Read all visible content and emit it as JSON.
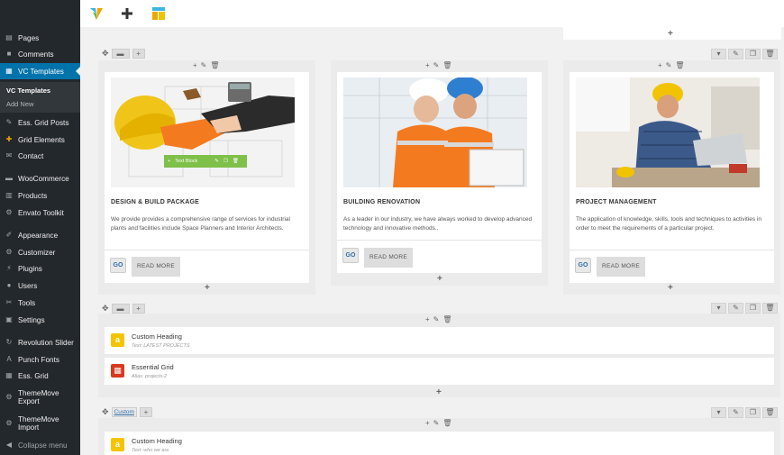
{
  "sidebar": {
    "items": [
      {
        "label": "Pages",
        "icon": "pages-icon"
      },
      {
        "label": "Comments",
        "icon": "comments-icon"
      },
      {
        "label": "VC Templates",
        "icon": "vc-templates-icon"
      },
      {
        "label": "Ess. Grid Posts",
        "icon": "pin-icon"
      },
      {
        "label": "Grid Elements",
        "icon": "grid-elements-icon"
      },
      {
        "label": "Contact",
        "icon": "mail-icon"
      },
      {
        "label": "WooCommerce",
        "icon": "woocommerce-icon"
      },
      {
        "label": "Products",
        "icon": "products-icon"
      },
      {
        "label": "Envato Toolkit",
        "icon": "toolkit-icon"
      },
      {
        "label": "Appearance",
        "icon": "brush-icon"
      },
      {
        "label": "Customizer",
        "icon": "customizer-icon"
      },
      {
        "label": "Plugins",
        "icon": "plugin-icon"
      },
      {
        "label": "Users",
        "icon": "user-icon"
      },
      {
        "label": "Tools",
        "icon": "wrench-icon"
      },
      {
        "label": "Settings",
        "icon": "settings-icon"
      },
      {
        "label": "Revolution Slider",
        "icon": "refresh-icon"
      },
      {
        "label": "Punch Fonts",
        "icon": "font-icon"
      },
      {
        "label": "Ess. Grid",
        "icon": "grid-icon"
      },
      {
        "label": "ThemeMove Export",
        "icon": "export-icon"
      },
      {
        "label": "ThemeMove Import",
        "icon": "import-icon"
      },
      {
        "label": "Collapse menu",
        "icon": "collapse-icon"
      }
    ],
    "submenu": [
      "VC Templates",
      "Add New"
    ]
  },
  "row1": {
    "columns": [
      {
        "title": "DESIGN & BUILD PACKAGE",
        "text": "We provide  provides a comprehensive range of services for industrial plants and facilities include Space Planners and Interior Architects.",
        "go": "GO",
        "more": "READ MORE",
        "overlay": "Text Block"
      },
      {
        "title": "BUILDING RENOVATION",
        "text": "As a leader in our industry, we have always worked to develop advanced technology and innovative methods..",
        "go": "GO",
        "more": "READ MORE"
      },
      {
        "title": "PROJECT MANAGEMENT",
        "text": "The application of knowledge, skills, tools and techniques to activities in order to meet the requirements of a particular project.",
        "go": "GO",
        "more": "READ MORE"
      }
    ]
  },
  "row2": {
    "elements": [
      {
        "title": "Custom Heading",
        "sub": "Text: LATEST PROJECTS",
        "color": "#f5c400",
        "glyph": "a"
      },
      {
        "title": "Essential Grid",
        "sub": "Alias: projects-2",
        "color": "#d9391e",
        "glyph": "▦"
      }
    ]
  },
  "row3": {
    "badge": "Custom",
    "elements": [
      {
        "title": "Custom Heading",
        "sub": "Text: who we are",
        "color": "#f5c400",
        "glyph": "a"
      }
    ]
  }
}
